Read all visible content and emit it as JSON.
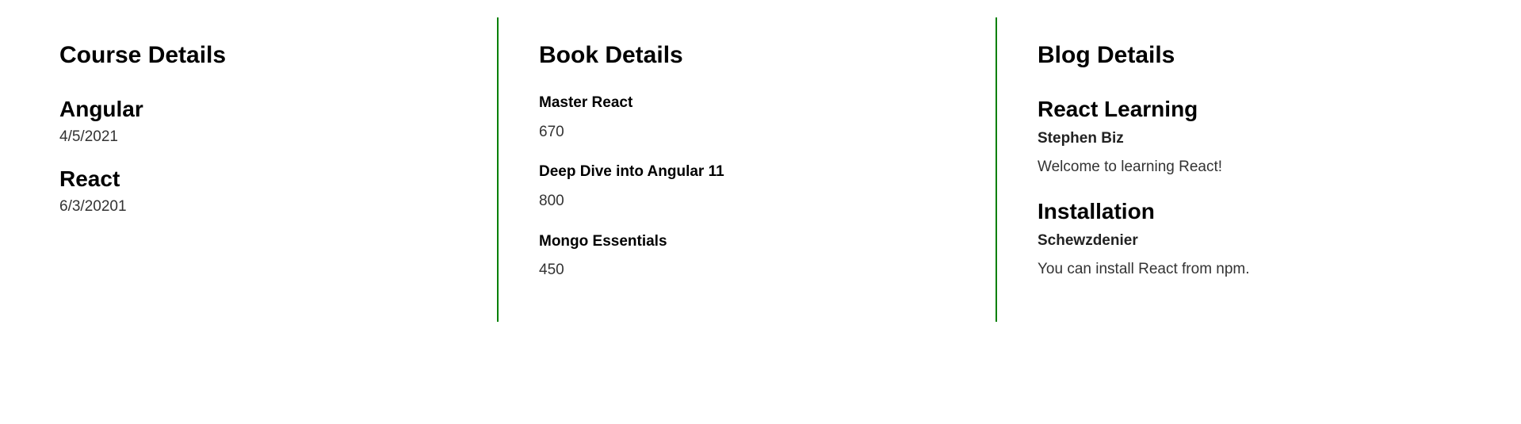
{
  "course": {
    "heading": "Course Details",
    "items": [
      {
        "name": "Angular",
        "date": "4/5/2021"
      },
      {
        "name": "React",
        "date": "6/3/20201"
      }
    ]
  },
  "book": {
    "heading": "Book Details",
    "items": [
      {
        "name": "Master React",
        "price": "670"
      },
      {
        "name": "Deep Dive into Angular 11",
        "price": "800"
      },
      {
        "name": "Mongo Essentials",
        "price": "450"
      }
    ]
  },
  "blog": {
    "heading": "Blog Details",
    "items": [
      {
        "title": "React Learning",
        "author": "Stephen Biz",
        "content": "Welcome to learning React!"
      },
      {
        "title": "Installation",
        "author": "Schewzdenier",
        "content": "You can install React from npm."
      }
    ]
  },
  "colors": {
    "divider": "#008000"
  }
}
